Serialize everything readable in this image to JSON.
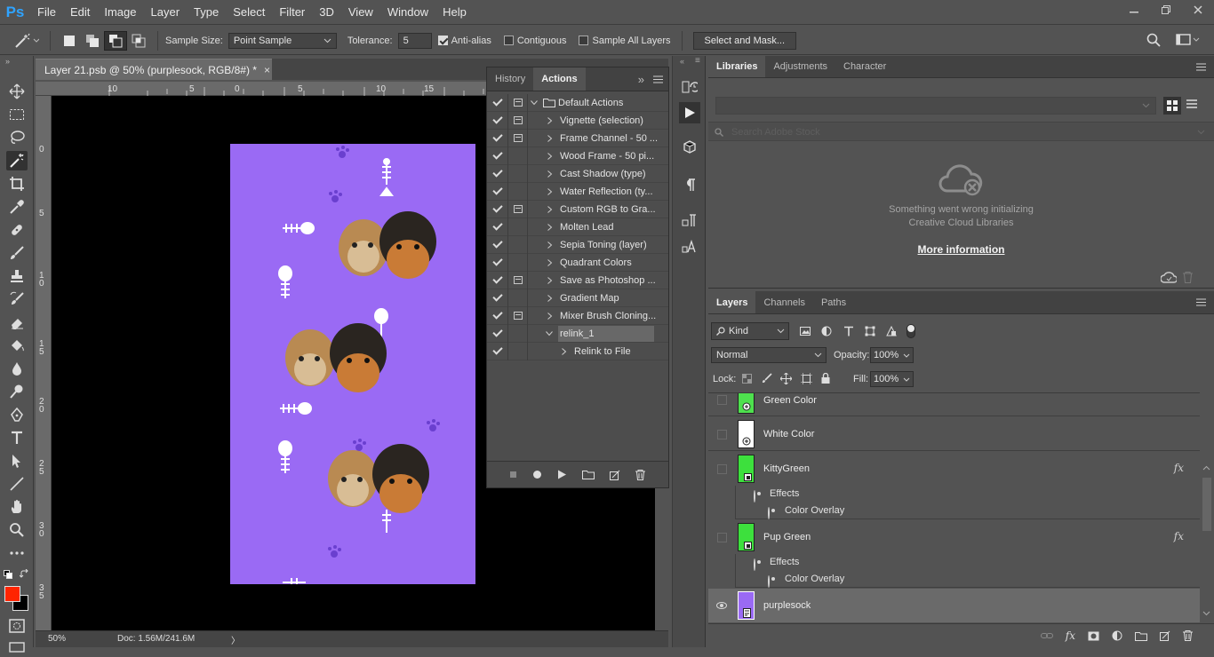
{
  "app": {
    "logo": "Ps"
  },
  "menu": [
    "File",
    "Edit",
    "Image",
    "Layer",
    "Type",
    "Select",
    "Filter",
    "3D",
    "View",
    "Window",
    "Help"
  ],
  "options": {
    "sample_size_label": "Sample Size:",
    "sample_size_value": "Point Sample",
    "tolerance_label": "Tolerance:",
    "tolerance_value": "5",
    "antialias": "Anti-alias",
    "contiguous": "Contiguous",
    "sample_all_layers": "Sample All Layers",
    "select_mask": "Select and Mask..."
  },
  "document": {
    "tab_title": "Layer 21.psb @ 50% (purplesock, RGB/8#) *",
    "close": "×",
    "zoom": "50%",
    "doc_info": "Doc: 1.56M/241.6M",
    "status_arrow": "〉",
    "ruler_top": [
      "10",
      "5",
      "0",
      "5",
      "10",
      "15"
    ],
    "ruler_left": [
      "0",
      "5",
      "1 0",
      "1 5",
      "2 0",
      "2 5",
      "3 0",
      "3 5"
    ]
  },
  "actions_panel": {
    "tabs": [
      "History",
      "Actions"
    ],
    "expand_glyph": "»",
    "set_name": "Default Actions",
    "items": [
      {
        "label": "Vignette (selection)",
        "dialog": true
      },
      {
        "label": "Frame Channel - 50 ...",
        "dialog": true
      },
      {
        "label": "Wood Frame - 50 pi...",
        "dialog": false
      },
      {
        "label": "Cast Shadow (type)",
        "dialog": false
      },
      {
        "label": "Water Reflection (ty...",
        "dialog": false
      },
      {
        "label": "Custom RGB to Gra...",
        "dialog": true
      },
      {
        "label": "Molten Lead",
        "dialog": false
      },
      {
        "label": "Sepia Toning (layer)",
        "dialog": false
      },
      {
        "label": "Quadrant Colors",
        "dialog": false
      },
      {
        "label": "Save as Photoshop ...",
        "dialog": true
      },
      {
        "label": "Gradient Map",
        "dialog": false
      },
      {
        "label": "Mixer Brush Cloning...",
        "dialog": true
      }
    ],
    "relink_action": "relink_1",
    "relink_step": "Relink to File"
  },
  "libraries_panel": {
    "tabs": [
      "Libraries",
      "Adjustments",
      "Character"
    ],
    "search_placeholder": "Search Adobe Stock",
    "error_line1": "Something went wrong initializing",
    "error_line2": "Creative Cloud Libraries",
    "more_info": "More information"
  },
  "layers_panel": {
    "tabs": [
      "Layers",
      "Channels",
      "Paths"
    ],
    "kind": "Kind",
    "blend_mode": "Normal",
    "opacity_label": "Opacity:",
    "opacity_value": "100%",
    "lock_label": "Lock:",
    "fill_label": "Fill:",
    "fill_value": "100%",
    "fx": "fx",
    "effects_label": "Effects",
    "color_overlay_label": "Color Overlay",
    "layers": [
      {
        "name": "Green Color",
        "visible": false,
        "thumb": "#4ee04e"
      },
      {
        "name": "White Color",
        "visible": false,
        "thumb": "#ffffff"
      },
      {
        "name": "KittyGreen",
        "visible": false,
        "thumb": "#3de03d"
      },
      {
        "name": "Pup Green",
        "visible": false,
        "thumb": "#3de03d"
      },
      {
        "name": "purplesock",
        "visible": true,
        "thumb": "#9a6af4"
      }
    ]
  },
  "colors": {
    "canvas": "#9a6af4",
    "foreground": "#ff2400",
    "background": "#000000",
    "accent": "#2fa3ff"
  }
}
